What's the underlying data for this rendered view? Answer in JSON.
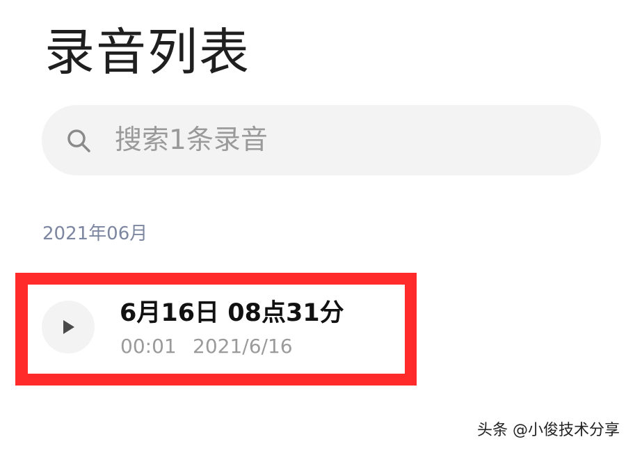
{
  "header": {
    "title": "录音列表"
  },
  "search": {
    "icon": "search-icon",
    "placeholder": "搜索1条录音"
  },
  "sections": [
    {
      "label": "2021年06月",
      "recordings": [
        {
          "play_icon": "play-icon",
          "title": "6月16日 08点31分",
          "duration": "00:01",
          "date": "2021/6/16"
        }
      ]
    }
  ],
  "annotation": {
    "highlight_color": "#ff2a2a"
  },
  "watermark": "头条 @小俊技术分享",
  "colors": {
    "background": "#ffffff",
    "search_bg": "#f3f3f3",
    "section_header": "#7d86a0",
    "secondary_text": "#9a9a9a"
  }
}
